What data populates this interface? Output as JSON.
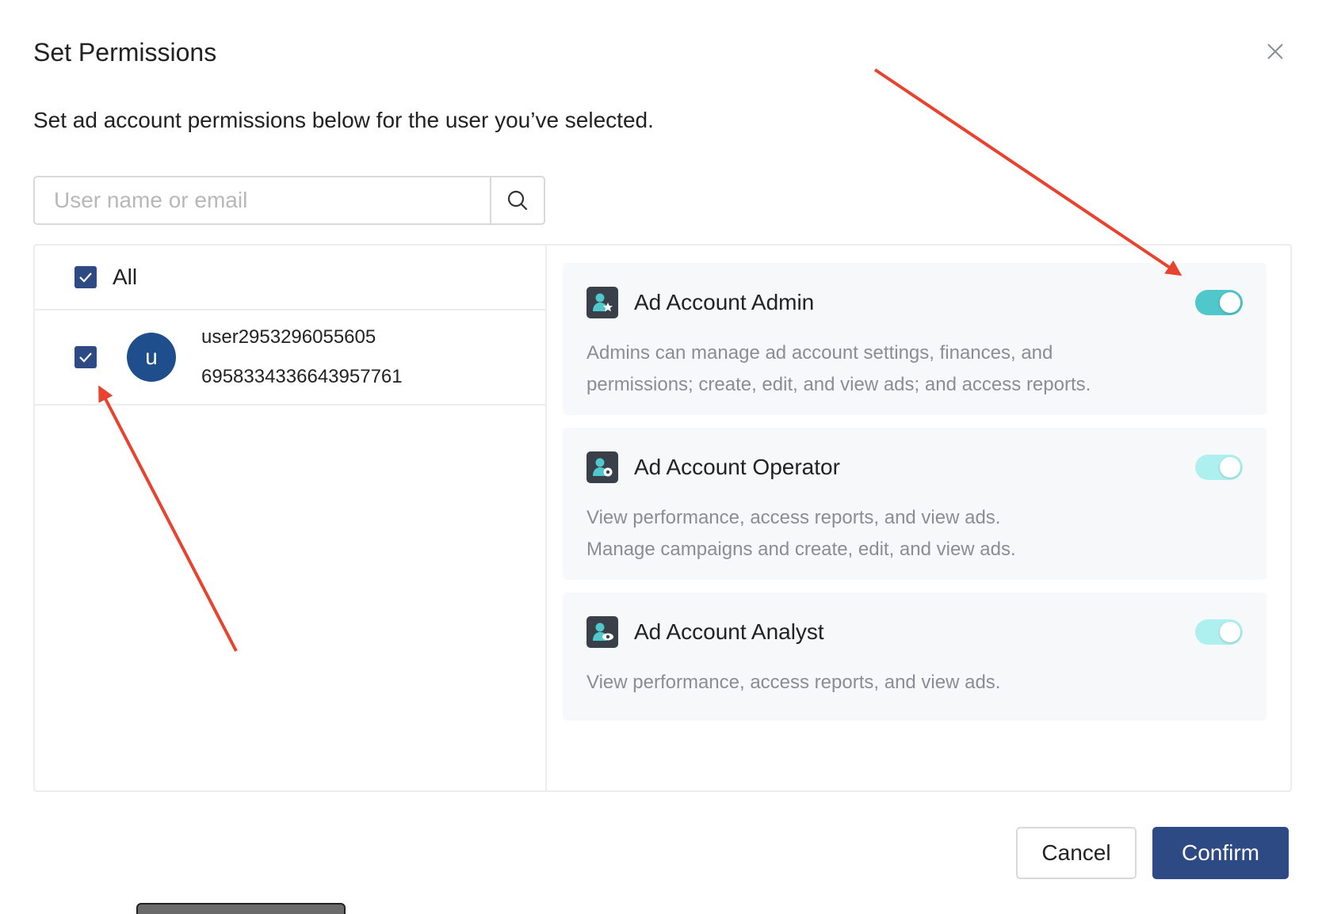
{
  "dialog": {
    "title": "Set Permissions",
    "subtitle": "Set ad account permissions below for the user you’ve selected."
  },
  "search": {
    "placeholder": "User name or email",
    "value": ""
  },
  "user_list": {
    "all_label": "All",
    "all_checked": true,
    "users": [
      {
        "avatar_letter": "u",
        "name": "user2953296055605",
        "id": "6958334336643957761",
        "checked": true
      }
    ]
  },
  "roles": [
    {
      "title": "Ad Account Admin",
      "icon": "user-star-icon",
      "enabled": true,
      "toggle_color": "#4fc7cb",
      "desc_lines": [
        "Admins can manage ad account settings, finances, and",
        "permissions; create, edit, and view ads; and access reports."
      ]
    },
    {
      "title": "Ad Account Operator",
      "icon": "user-gear-icon",
      "enabled": true,
      "toggle_color": "#aef0f0",
      "desc_lines": [
        "View performance, access reports, and view ads.",
        "Manage campaigns and create, edit, and view ads."
      ]
    },
    {
      "title": "Ad Account Analyst",
      "icon": "user-eye-icon",
      "enabled": true,
      "toggle_color": "#aef0f0",
      "desc_lines": [
        "View performance, access reports, and view ads."
      ]
    }
  ],
  "footer": {
    "cancel_label": "Cancel",
    "confirm_label": "Confirm"
  },
  "colors": {
    "primary": "#2e4a85",
    "avatar": "#1f4e8c",
    "annotation_arrow": "#e8432e"
  }
}
